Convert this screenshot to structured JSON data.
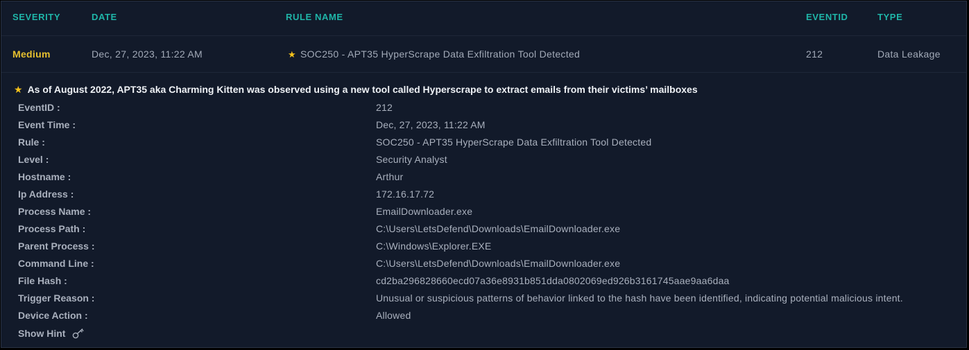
{
  "table": {
    "headers": {
      "severity": "SEVERITY",
      "date": "DATE",
      "rule_name": "RULE NAME",
      "eventid": "EVENTID",
      "type": "TYPE"
    },
    "row": {
      "severity": "Medium",
      "date": "Dec, 27, 2023, 11:22 AM",
      "rule_name": "SOC250 - APT35 HyperScrape Data Exfiltration Tool Detected",
      "eventid": "212",
      "type": "Data Leakage"
    }
  },
  "detail": {
    "headline": "As of August 2022, APT35 aka Charming Kitten was observed using a new tool called Hyperscrape to extract emails from their victims’ mailboxes",
    "fields": [
      {
        "label": "EventID :",
        "value": "212"
      },
      {
        "label": "Event Time :",
        "value": "Dec, 27, 2023, 11:22 AM"
      },
      {
        "label": "Rule :",
        "value": "SOC250 - APT35 HyperScrape Data Exfiltration Tool Detected"
      },
      {
        "label": "Level :",
        "value": "Security Analyst"
      },
      {
        "label": "Hostname :",
        "value": "Arthur"
      },
      {
        "label": "Ip Address :",
        "value": "172.16.17.72"
      },
      {
        "label": "Process Name :",
        "value": "EmailDownloader.exe"
      },
      {
        "label": "Process Path :",
        "value": "C:\\Users\\LetsDefend\\Downloads\\EmailDownloader.exe"
      },
      {
        "label": "Parent Process :",
        "value": "C:\\Windows\\Explorer.EXE"
      },
      {
        "label": "Command Line :",
        "value": "C:\\Users\\LetsDefend\\Downloads\\EmailDownloader.exe"
      },
      {
        "label": "File Hash :",
        "value": "cd2ba296828660ecd07a36e8931b851dda0802069ed926b3161745aae9aa6daa"
      },
      {
        "label": "Trigger Reason :",
        "value": "Unusual or suspicious patterns of behavior linked to the hash have been identified, indicating potential malicious intent."
      },
      {
        "label": "Device Action :",
        "value": "Allowed"
      }
    ],
    "hint_label": "Show Hint",
    "hint_icon": "key-icon"
  },
  "colors": {
    "header_accent": "#1fb5a8",
    "severity_medium": "#e6c02f",
    "star": "#f7c31a",
    "background": "#121a2a"
  }
}
